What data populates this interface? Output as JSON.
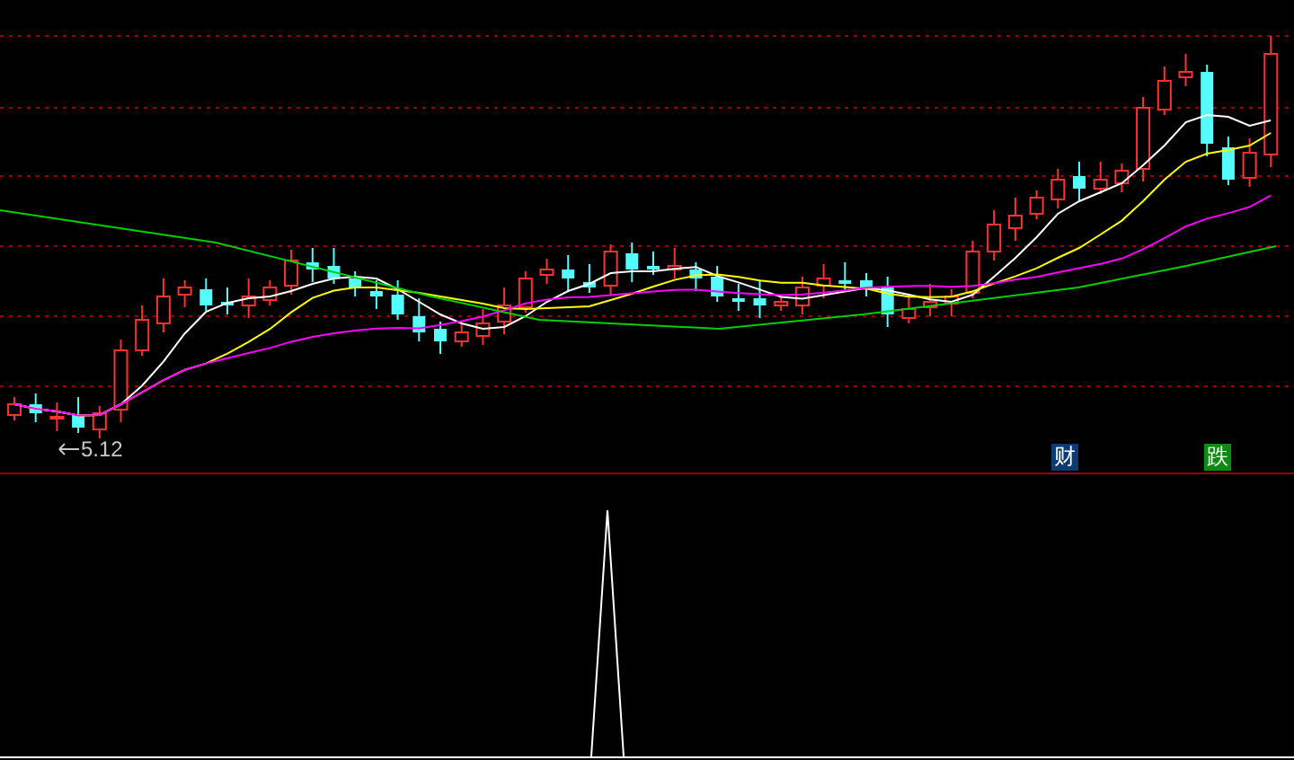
{
  "price_panel": {
    "low_marker": {
      "value": "5.12"
    },
    "badges": [
      {
        "label": "财",
        "color": "#0b3b72"
      },
      {
        "label": "跌",
        "color": "#0c8a12"
      }
    ]
  }
}
